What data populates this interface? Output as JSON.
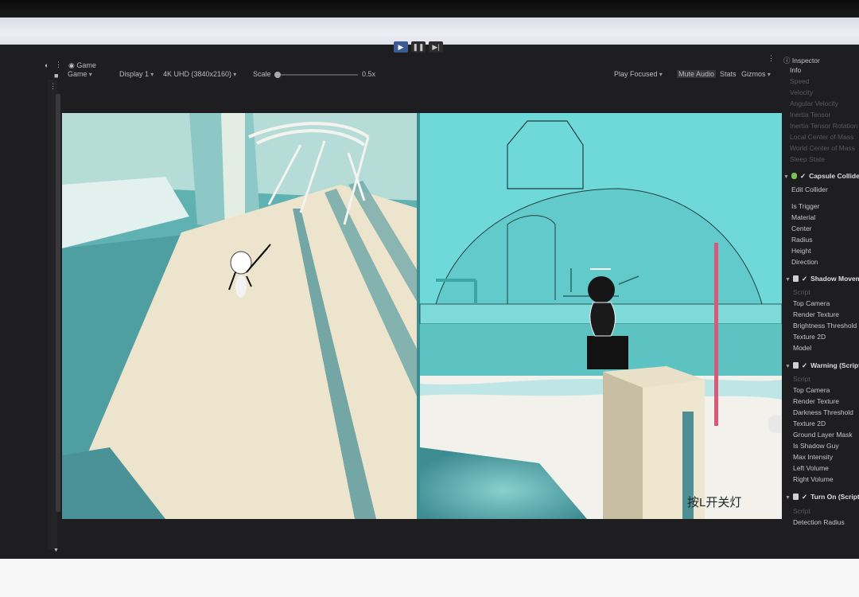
{
  "playmode": {
    "play": "▶",
    "pause": "❚❚",
    "step": "▶|"
  },
  "game_tab": {
    "lock_icon": "🔒",
    "more": "⋮",
    "tab_label": "Game",
    "game_dropdown": "Game"
  },
  "toolbar": {
    "display": "Display 1",
    "resolution": "4K UHD (3840x2160)",
    "scale_label": "Scale",
    "scale_value": "0.5x",
    "play_focused": "Play Focused",
    "mute_audio": "Mute Audio",
    "stats": "Stats",
    "gizmos": "Gizmos"
  },
  "inspector": {
    "title": "Inspector",
    "info": "Info",
    "info_items": [
      "Speed",
      "Velocity",
      "Angular Velocity",
      "Inertia Tensor",
      "Inertia Tensor Rotation",
      "Local Center of Mass",
      "World Center of Mass",
      "Sleep State"
    ],
    "capsule": {
      "name": "Capsule Collider",
      "edit": "Edit Collider",
      "fields": [
        "Is Trigger",
        "Material",
        "Center",
        "Radius",
        "Height",
        "Direction"
      ]
    },
    "shadow": {
      "name": "Shadow Movement (Script)",
      "fields": [
        "Script",
        "Top Camera",
        "Render Texture",
        "Brightness Threshold",
        "Texture 2D",
        "Model"
      ]
    },
    "warning": {
      "name": "Warning (Script)",
      "fields": [
        "Script",
        "Top Camera",
        "Render Texture",
        "Darkness Threshold",
        "Texture 2D",
        "Ground Layer Mask",
        "Is Shadow Guy",
        "Max Intensity",
        "Left Volume",
        "Right Volume"
      ]
    },
    "turnon": {
      "name": "Turn On (Script)",
      "fields": [
        "Script",
        "Detection Radius"
      ]
    }
  },
  "game_view": {
    "caption": "按L开关灯"
  },
  "colors": {
    "accent_play": "#3b5b95",
    "viewport_teal": "#6cc6c4",
    "floor_cream": "#ece4cc",
    "pole_pink": "#d85a78"
  }
}
